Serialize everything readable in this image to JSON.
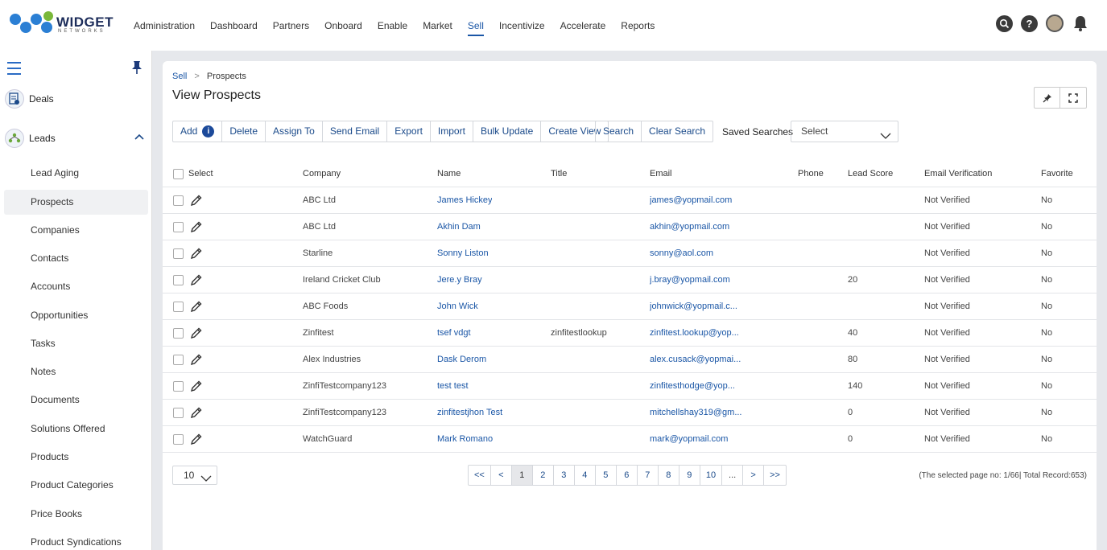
{
  "brand": {
    "name": "WIDGET",
    "tagline": "NETWORKS"
  },
  "nav": [
    {
      "label": "Administration",
      "active": false
    },
    {
      "label": "Dashboard",
      "active": false
    },
    {
      "label": "Partners",
      "active": false
    },
    {
      "label": "Onboard",
      "active": false
    },
    {
      "label": "Enable",
      "active": false
    },
    {
      "label": "Market",
      "active": false
    },
    {
      "label": "Sell",
      "active": true
    },
    {
      "label": "Incentivize",
      "active": false
    },
    {
      "label": "Accelerate",
      "active": false
    },
    {
      "label": "Reports",
      "active": false
    }
  ],
  "top_icons": [
    "search-icon",
    "help-icon",
    "avatar",
    "bell-icon"
  ],
  "sidebar": {
    "groups": [
      {
        "label": "Deals",
        "icon": "deals-icon"
      },
      {
        "label": "Leads",
        "icon": "leads-icon",
        "expanded": true
      }
    ],
    "items": [
      {
        "label": "Lead Aging",
        "active": false
      },
      {
        "label": "Prospects",
        "active": true
      },
      {
        "label": "Companies",
        "active": false
      },
      {
        "label": "Contacts",
        "active": false
      },
      {
        "label": "Accounts",
        "active": false
      },
      {
        "label": "Opportunities",
        "active": false
      },
      {
        "label": "Tasks",
        "active": false
      },
      {
        "label": "Notes",
        "active": false
      },
      {
        "label": "Documents",
        "active": false
      },
      {
        "label": "Solutions Offered",
        "active": false
      },
      {
        "label": "Products",
        "active": false
      },
      {
        "label": "Product Categories",
        "active": false
      },
      {
        "label": "Price Books",
        "active": false
      },
      {
        "label": "Product Syndications",
        "active": false
      }
    ]
  },
  "breadcrumb": {
    "parent": "Sell",
    "separator": ">",
    "current": "Prospects"
  },
  "page_title": "View Prospects",
  "toolbar": {
    "actions": [
      "Add",
      "Delete",
      "Assign To",
      "Send Email",
      "Export",
      "Import",
      "Bulk Update",
      "Create View"
    ],
    "search": [
      "Search",
      "Clear Search"
    ],
    "saved_searches_label": "Saved Searches",
    "saved_searches_value": "Select"
  },
  "table": {
    "headers": [
      "Select",
      "Company",
      "Name",
      "Title",
      "Email",
      "Phone",
      "Lead Score",
      "Email Verification",
      "Favorite"
    ],
    "rows": [
      {
        "company": "ABC Ltd",
        "name": "James Hickey",
        "title": "",
        "email": "james@yopmail.com",
        "phone": "",
        "score": "",
        "verification": "Not Verified",
        "favorite": "No"
      },
      {
        "company": "ABC Ltd",
        "name": "Akhin Dam",
        "title": "",
        "email": "akhin@yopmail.com",
        "phone": "",
        "score": "",
        "verification": "Not Verified",
        "favorite": "No"
      },
      {
        "company": "Starline",
        "name": "Sonny Liston",
        "title": "",
        "email": "sonny@aol.com",
        "phone": "",
        "score": "",
        "verification": "Not Verified",
        "favorite": "No"
      },
      {
        "company": "Ireland Cricket Club",
        "name": "Jere.y Bray",
        "title": "",
        "email": "j.bray@yopmail.com",
        "phone": "",
        "score": "20",
        "verification": "Not Verified",
        "favorite": "No"
      },
      {
        "company": "ABC Foods",
        "name": "John Wick",
        "title": "",
        "email": "johnwick@yopmail.c...",
        "phone": "",
        "score": "",
        "verification": "Not Verified",
        "favorite": "No"
      },
      {
        "company": "Zinfitest",
        "name": "tsef vdgt",
        "title": "zinfitestlookup",
        "email": "zinfitest.lookup@yop...",
        "phone": "",
        "score": "40",
        "verification": "Not Verified",
        "favorite": "No"
      },
      {
        "company": "Alex Industries",
        "name": "Dask Derom",
        "title": "",
        "email": "alex.cusack@yopmai...",
        "phone": "",
        "score": "80",
        "verification": "Not Verified",
        "favorite": "No"
      },
      {
        "company": "ZinfiTestcompany123",
        "name": "test test",
        "title": "",
        "email": "zinfitesthodge@yop...",
        "phone": "",
        "score": "140",
        "verification": "Not Verified",
        "favorite": "No"
      },
      {
        "company": "ZinfiTestcompany123",
        "name": "zinfitestjhon Test",
        "title": "",
        "email": "mitchellshay319@gm...",
        "phone": "",
        "score": "0",
        "verification": "Not Verified",
        "favorite": "No"
      },
      {
        "company": "WatchGuard",
        "name": "Mark Romano",
        "title": "",
        "email": "mark@yopmail.com",
        "phone": "",
        "score": "0",
        "verification": "Not Verified",
        "favorite": "No"
      }
    ]
  },
  "pagination": {
    "page_size": "10",
    "buttons": [
      "<<",
      "<",
      "1",
      "2",
      "3",
      "4",
      "5",
      "6",
      "7",
      "8",
      "9",
      "10",
      "...",
      ">",
      ">>"
    ],
    "active": "1",
    "info": "(The selected page no: 1/66| Total Record:653)"
  },
  "colors": {
    "accent": "#1a56a6",
    "nav_dark": "#1c2c5a"
  }
}
